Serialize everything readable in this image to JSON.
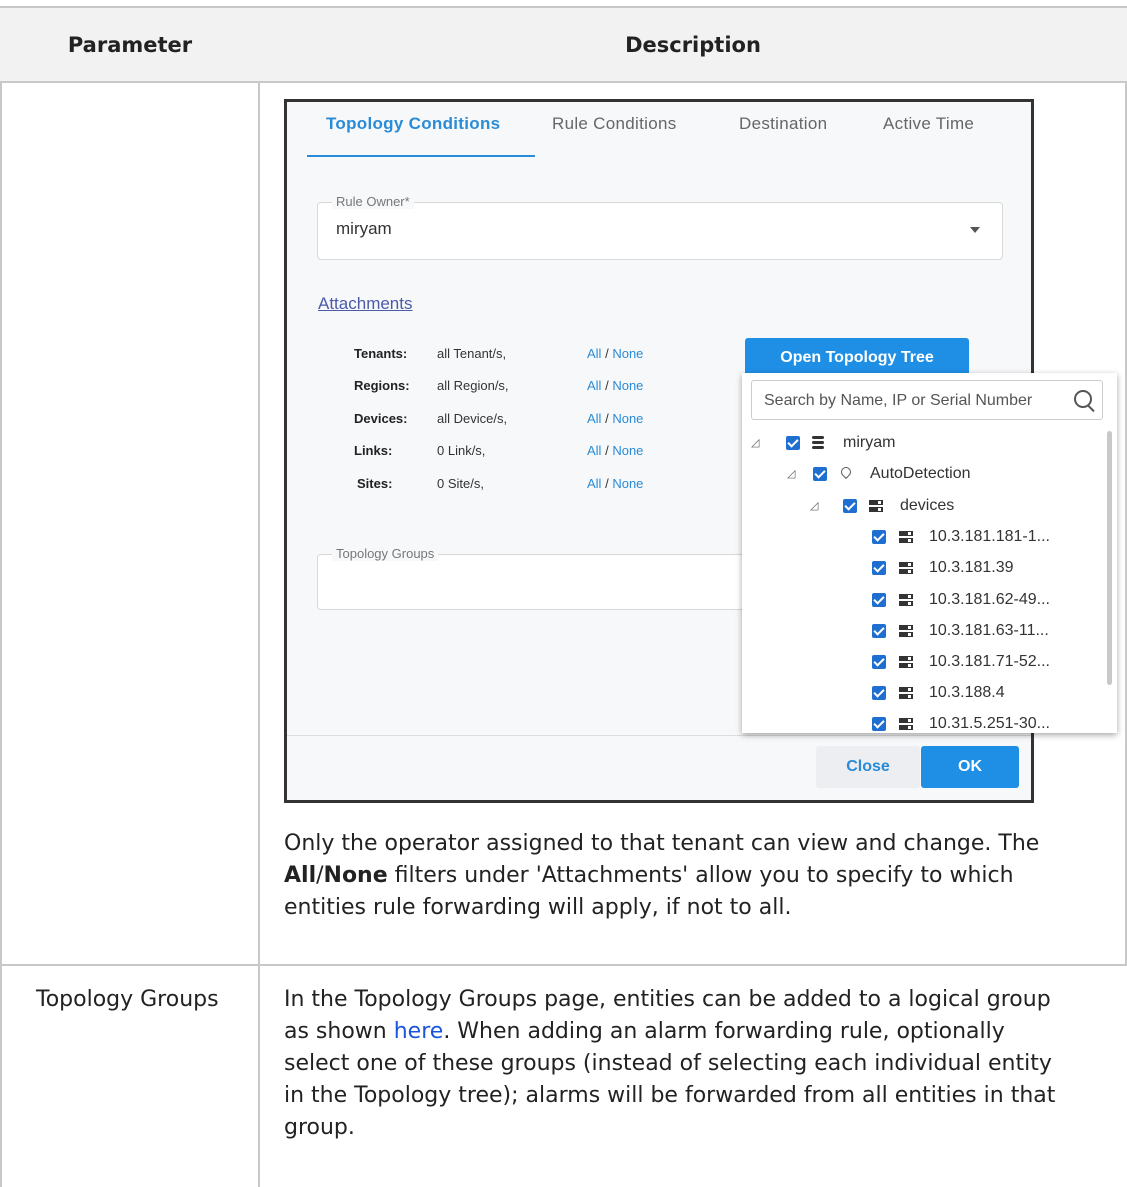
{
  "table": {
    "header": {
      "parameter": "Parameter",
      "description": "Description"
    }
  },
  "screenshot": {
    "tabs": [
      "Topology Conditions",
      "Rule Conditions",
      "Destination",
      "Active Time"
    ],
    "rule_owner": {
      "legend": "Rule Owner*",
      "value": "miryam"
    },
    "attachments_label": "Attachments",
    "attachments": [
      {
        "label": "Tenants:",
        "value": "all Tenant/s,",
        "all": "All",
        "sep": "/",
        "none": "None"
      },
      {
        "label": "Regions:",
        "value": "all Region/s,",
        "all": "All",
        "sep": "/",
        "none": "None"
      },
      {
        "label": "Devices:",
        "value": "all Device/s,",
        "all": "All",
        "sep": "/",
        "none": "None"
      },
      {
        "label": "Links:",
        "value": "0 Link/s,",
        "all": "All",
        "sep": "/",
        "none": "None"
      },
      {
        "label": "Sites:",
        "value": "0 Site/s,",
        "all": "All",
        "sep": "/",
        "none": "None"
      }
    ],
    "open_tree_button": "Open Topology Tree",
    "topology_groups_legend": "Topology Groups",
    "close_button": "Close",
    "ok_button": "OK",
    "tree": {
      "search_placeholder": "Search by Name, IP or Serial Number",
      "nodes": [
        {
          "label": "miryam",
          "icon": "database-icon"
        },
        {
          "label": "AutoDetection",
          "icon": "location-pin-icon"
        },
        {
          "label": "devices",
          "icon": "server-icon"
        },
        {
          "label": "10.3.181.181-1...",
          "icon": "server-icon"
        },
        {
          "label": "10.3.181.39",
          "icon": "server-icon"
        },
        {
          "label": "10.3.181.62-49...",
          "icon": "server-icon"
        },
        {
          "label": "10.3.181.63-11...",
          "icon": "server-icon"
        },
        {
          "label": "10.3.181.71-52...",
          "icon": "server-icon"
        },
        {
          "label": "10.3.188.4",
          "icon": "server-icon"
        },
        {
          "label": "10.31.5.251-30...",
          "icon": "server-icon"
        }
      ]
    }
  },
  "row1_text": {
    "line1": "Only the operator assigned to that tenant can view and change. The",
    "l2_all": "All",
    "l2_slash": "/",
    "l2_none": "None",
    "l2_rest": " filters under 'Attachments' allow you to specify to which",
    "line3": "entities rule forwarding will apply, if not to all."
  },
  "row2": {
    "parameter": "Topology Groups",
    "line1": "In the Topology Groups page, entities can be added to a logical group",
    "l2_pre": "as shown ",
    "l2_link": "here",
    "l2_post": ". When adding an alarm forwarding rule, optionally",
    "line3": "select one of these groups (instead of selecting each individual entity",
    "line4": "in the Topology tree); alarms will be forwarded from all entities in that",
    "line5": "group."
  }
}
